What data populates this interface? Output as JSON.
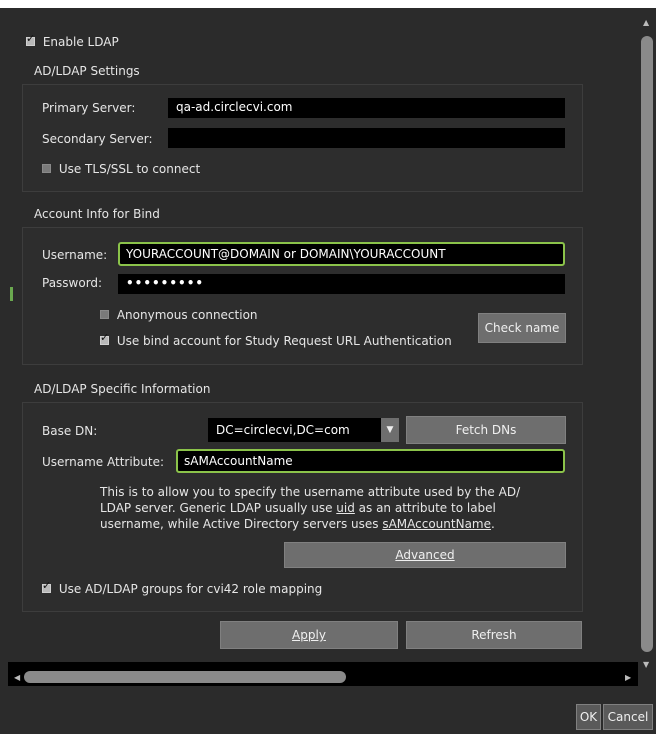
{
  "enable_ldap": {
    "label": "Enable LDAP",
    "checked": true
  },
  "ad_ldap_settings": {
    "title": "AD/LDAP Settings",
    "primary_label": "Primary Server:",
    "primary_value": "qa-ad.circlecvi.com",
    "secondary_label": "Secondary Server:",
    "secondary_value": "",
    "tls_label": "Use TLS/SSL to connect",
    "tls_checked": false
  },
  "bind": {
    "title": "Account Info for Bind",
    "username_label": "Username:",
    "username_value": "YOURACCOUNT@DOMAIN or DOMAIN\\YOURACCOUNT",
    "password_label": "Password:",
    "password_value": "•••••••••",
    "anonymous_label": "Anonymous connection",
    "anonymous_checked": false,
    "study_label": "Use bind account for Study Request URL Authentication",
    "study_checked": true,
    "check_name_label": "Check name"
  },
  "specific": {
    "title": "AD/LDAP Specific Information",
    "base_dn_label": "Base DN:",
    "base_dn_value": "DC=circlecvi,DC=com",
    "fetch_label": "Fetch DNs",
    "attr_label": "Username Attribute:",
    "attr_value": "sAMAccountName",
    "help_line1": "This is to allow you to specify the username attribute used by the AD/",
    "help_line2": "LDAP server. Generic LDAP usually use ",
    "help_link1": "uid",
    "help_line2b": " as an attribute to label",
    "help_line3": "username, while Active Directory servers uses ",
    "help_link2": "sAMAccountName",
    "help_line3b": ".",
    "advanced_label": "Advanced",
    "groups_label": "Use AD/LDAP groups for cvi42 role mapping",
    "groups_checked": true
  },
  "actions": {
    "apply_label": "Apply",
    "refresh_label": "Refresh"
  },
  "footer": {
    "ok_label": "OK",
    "cancel_label": "Cancel"
  }
}
